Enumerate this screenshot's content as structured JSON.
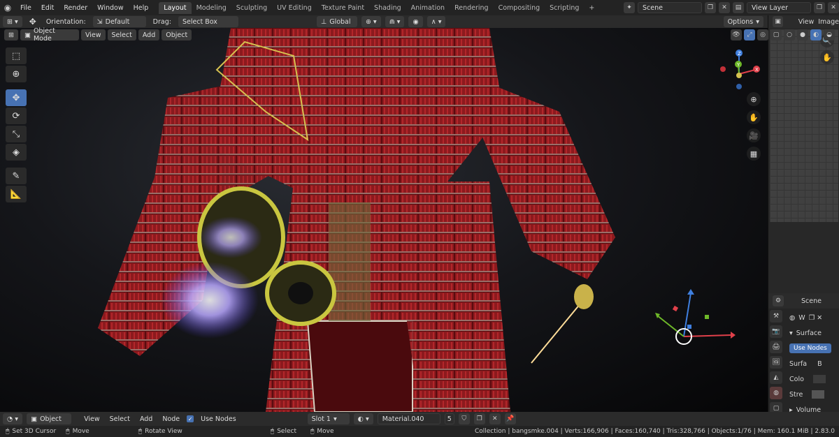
{
  "menu": [
    "File",
    "Edit",
    "Render",
    "Window",
    "Help"
  ],
  "tabs": [
    "Layout",
    "Modeling",
    "Sculpting",
    "UV Editing",
    "Texture Paint",
    "Shading",
    "Animation",
    "Rendering",
    "Compositing",
    "Scripting"
  ],
  "active_tab": "Layout",
  "scene": "Scene",
  "view_layer": "View Layer",
  "header": {
    "orientation_label": "Orientation:",
    "orientation_value": "Default",
    "drag_label": "Drag:",
    "drag_value": "Select Box",
    "transform": "Global",
    "options": "Options"
  },
  "viewport_header": {
    "mode": "Object Mode",
    "items": [
      "View",
      "Select",
      "Add",
      "Object"
    ]
  },
  "right_header": {
    "items": [
      "View",
      "Image"
    ]
  },
  "props": {
    "scene": "Scene",
    "world": "W",
    "surface_title": "Surface",
    "use_nodes": "Use Nodes",
    "rows": [
      "Surfa",
      "Colo",
      "Stre"
    ],
    "surface_value": "B",
    "volume": "Volume"
  },
  "shader_header": {
    "editor": "Object",
    "items": [
      "View",
      "Select",
      "Add",
      "Node"
    ],
    "use_nodes": "Use Nodes",
    "slot": "Slot 1",
    "material": "Material.040",
    "users": "5"
  },
  "status": {
    "left": [
      "Set 3D Cursor",
      "Move",
      "Rotate View",
      "Select",
      "Move"
    ],
    "stats": "Collection | bangsmke.004 | Verts:166,906 | Faces:160,740 | Tris:328,766 | Objects:1/76 | Mem: 160.1 MiB | 2.83.0"
  },
  "gizmo": {
    "x": "X",
    "y": "Y",
    "z": "Z"
  },
  "colors": {
    "accent": "#4772b3",
    "x_axis": "#e0404a",
    "y_axis": "#6eb829",
    "z_axis": "#3f7fdf"
  }
}
